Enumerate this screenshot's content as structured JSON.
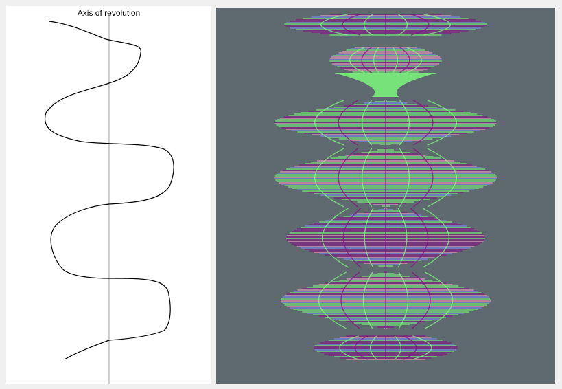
{
  "profile_panel": {
    "axis_label": "Axis of revolution"
  },
  "colors": {
    "panel_background": "#ffffff",
    "window_background": "#f0f0f0",
    "viewport_background": "#5f6970",
    "axis_line": "#a0a0a0",
    "profile_curve": "#000000",
    "mesh_green": "#7dff7d",
    "mesh_purple": "#8a0a8a",
    "mesh_pink": "#ff9fc8",
    "mesh_blue": "#7d8cff"
  }
}
